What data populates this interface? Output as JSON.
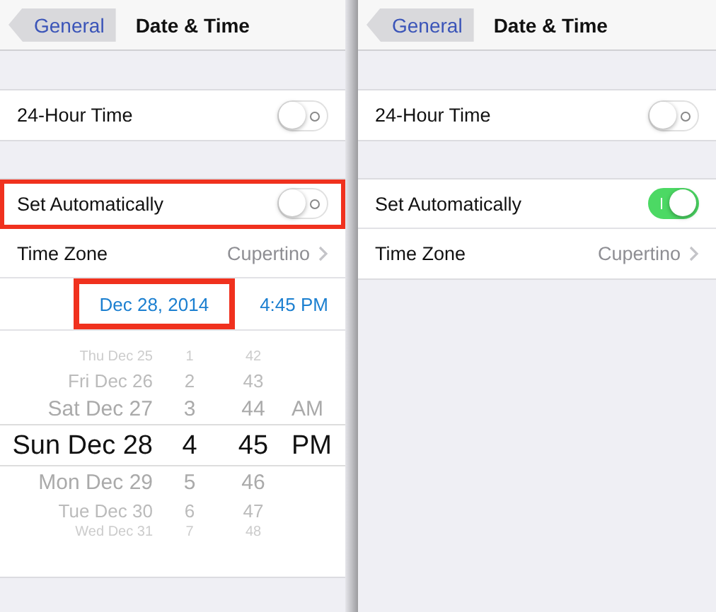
{
  "panels": [
    {
      "nav": {
        "back": "General",
        "title": "Date & Time"
      },
      "sections": [
        {
          "rows": [
            {
              "kind": "toggle",
              "label": "24-Hour Time",
              "on": false,
              "highlighted": false
            }
          ]
        },
        {
          "rows": [
            {
              "kind": "toggle",
              "label": "Set Automatically",
              "on": false,
              "highlighted": true
            },
            {
              "kind": "detail",
              "label": "Time Zone",
              "value": "Cupertino"
            },
            {
              "kind": "datetime",
              "date": "Dec 28, 2014",
              "time": "4:45 PM",
              "highlighted": true
            },
            {
              "kind": "picker",
              "columns": [
                {
                  "items": [
                    {
                      "text": "Thu Dec 25",
                      "selected": false
                    },
                    {
                      "text": "Fri Dec 26",
                      "selected": false
                    },
                    {
                      "text": "Sat Dec 27",
                      "selected": false
                    },
                    {
                      "text": "Sun Dec 28",
                      "selected": true
                    },
                    {
                      "text": "Mon Dec 29",
                      "selected": false
                    },
                    {
                      "text": "Tue Dec 30",
                      "selected": false
                    },
                    {
                      "text": "Wed Dec 31",
                      "selected": false
                    }
                  ]
                },
                {
                  "items": [
                    {
                      "text": "1",
                      "selected": false
                    },
                    {
                      "text": "2",
                      "selected": false
                    },
                    {
                      "text": "3",
                      "selected": false
                    },
                    {
                      "text": "4",
                      "selected": true
                    },
                    {
                      "text": "5",
                      "selected": false
                    },
                    {
                      "text": "6",
                      "selected": false
                    },
                    {
                      "text": "7",
                      "selected": false
                    }
                  ]
                },
                {
                  "items": [
                    {
                      "text": "42",
                      "selected": false
                    },
                    {
                      "text": "43",
                      "selected": false
                    },
                    {
                      "text": "44",
                      "selected": false
                    },
                    {
                      "text": "45",
                      "selected": true
                    },
                    {
                      "text": "46",
                      "selected": false
                    },
                    {
                      "text": "47",
                      "selected": false
                    },
                    {
                      "text": "48",
                      "selected": false
                    }
                  ]
                },
                {
                  "items": [
                    {
                      "text": "AM",
                      "selected": false
                    },
                    {
                      "text": "PM",
                      "selected": true
                    }
                  ]
                }
              ]
            }
          ]
        }
      ]
    },
    {
      "nav": {
        "back": "General",
        "title": "Date & Time"
      },
      "sections": [
        {
          "rows": [
            {
              "kind": "toggle",
              "label": "24-Hour Time",
              "on": false,
              "highlighted": false
            }
          ]
        },
        {
          "rows": [
            {
              "kind": "toggle",
              "label": "Set Automatically",
              "on": true,
              "highlighted": false
            },
            {
              "kind": "detail",
              "label": "Time Zone",
              "value": "Cupertino"
            }
          ]
        }
      ]
    }
  ]
}
